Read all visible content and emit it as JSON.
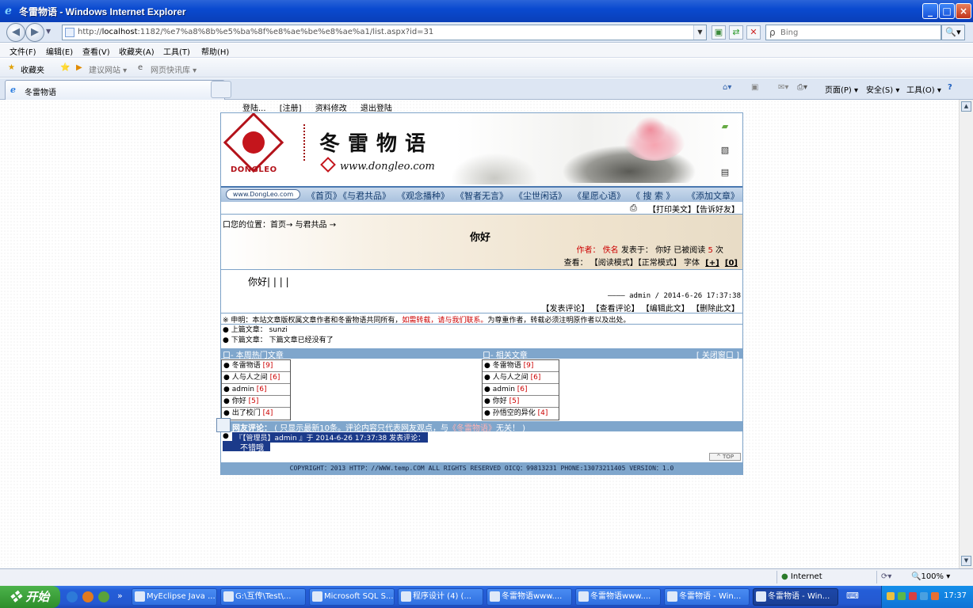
{
  "window": {
    "title": "冬雷物语 - Windows Internet Explorer",
    "icon": "ie-icon",
    "controls": [
      "_",
      "□",
      "×"
    ]
  },
  "address": {
    "url_prefix": "http://",
    "url_host": "localhost",
    "url_rest": ":1182/%e7%a8%8b%e5%ba%8f%e8%ae%be%e8%ae%a1/list.aspx?id=31",
    "search_placeholder": "Bing"
  },
  "menu": [
    "文件(F)",
    "编辑(E)",
    "查看(V)",
    "收藏夹(A)",
    "工具(T)",
    "帮助(H)"
  ],
  "favorites": {
    "label": "收藏夹",
    "items": [
      "建议网站 ▾",
      "网页快讯库 ▾"
    ]
  },
  "tab": {
    "label": "冬雷物语"
  },
  "commandbar": [
    "页面(P) ▾",
    "安全(S) ▾",
    "工具(O) ▾",
    "?"
  ],
  "page": {
    "top_links": [
      "登陆...",
      "[注册]",
      "资料修改",
      "退出登陆"
    ],
    "logo_text": "DONGLEO",
    "site_title": "冬雷物语",
    "site_url": "www.dongleo.com",
    "nav_badge": "www.DongLeo.com",
    "nav": [
      "《首页》",
      "《与君共品》",
      "《观念播种》",
      "《智者无言》",
      "《尘世闲话》",
      "《星愿心语》",
      "《  搜 索  》",
      "《添加文章》"
    ],
    "print_links": "【打印美文】【告诉好友】",
    "breadcrumb": "口您的位置：首页→ 与君共品 →",
    "article_title": "你好",
    "meta_author_label": "作者：",
    "meta_author": "佚名",
    "meta_published": "发表于：",
    "meta_title": "你好",
    "meta_read": "已被阅读",
    "meta_count": "5",
    "meta_times": "次",
    "view_label": "查看：",
    "view_modes": "【阅读模式】【正常模式】",
    "font_label": "字体",
    "font_plus": "[+]",
    "font_zero": "[0]",
    "body_text": "你好| | | |",
    "signature": "———— admin / 2014-6-26 17:37:38",
    "actions": "【发表评论】 【查看评论】 【编辑此文】 【删除此文】",
    "copyright_prefix": "※ 申明：本站文章版权属文章作者和冬雷物语共同所有，",
    "copyright_red": "如需转载，请与我们联系。",
    "copyright_suffix": "为尊重作者，转载必须注明原作者以及出处。",
    "prev_article": "● 上篇文章： sunzi",
    "next_article": "● 下篇文章： 下篇文章已经没有了",
    "hot_header": "口- 本周热门文章",
    "related_header": "口- 相关文章",
    "close_window": "[ 关闭窗口 ]",
    "hot_list": [
      {
        "title": "● 冬雷物语",
        "count": "[9]"
      },
      {
        "title": "● 人与人之间",
        "count": "[6]"
      },
      {
        "title": "● admin",
        "count": "[6]"
      },
      {
        "title": "● 你好",
        "count": "[5]"
      },
      {
        "title": "● 出了校门",
        "count": "[4]"
      }
    ],
    "related_list": [
      {
        "title": "● 冬雷物语",
        "count": "[9]"
      },
      {
        "title": "● 人与人之间",
        "count": "[6]"
      },
      {
        "title": "● admin",
        "count": "[6]"
      },
      {
        "title": "● 你好",
        "count": "[5]"
      },
      {
        "title": "● 孙悟空的异化",
        "count": "[4]"
      }
    ],
    "comment_label": "网友评论：",
    "comment_note": "( 只显示最新10条。评论内容只代表网友观点，与",
    "comment_site": "《冬雷物语》",
    "comment_note2": "无关！ )",
    "comment_line": "『【管理员】admin 』于 2014-6-26 17:37:38 发表评论：",
    "comment_text": "不错哦",
    "top_label": "TOP",
    "footer": "COPYRIGHT：2013 HTTP：//WWW.temp.COM ALL RIGHTS RESERVED OICQ：99813231 PHONE:13073211405 VERSION：1.0"
  },
  "status": {
    "zone": "Internet",
    "zoom": "100% ▾"
  },
  "taskbar": {
    "start": "开始",
    "tasks": [
      "MyEclipse Java ...",
      "G:\\互传\\Test\\...",
      "Microsoft SQL S...",
      "程序设计 (4) (...",
      "冬雷物语www....",
      "冬雷物语www....",
      "冬雷物语 - Win...",
      "冬雷物语 - Win..."
    ],
    "clock": "17:37"
  }
}
